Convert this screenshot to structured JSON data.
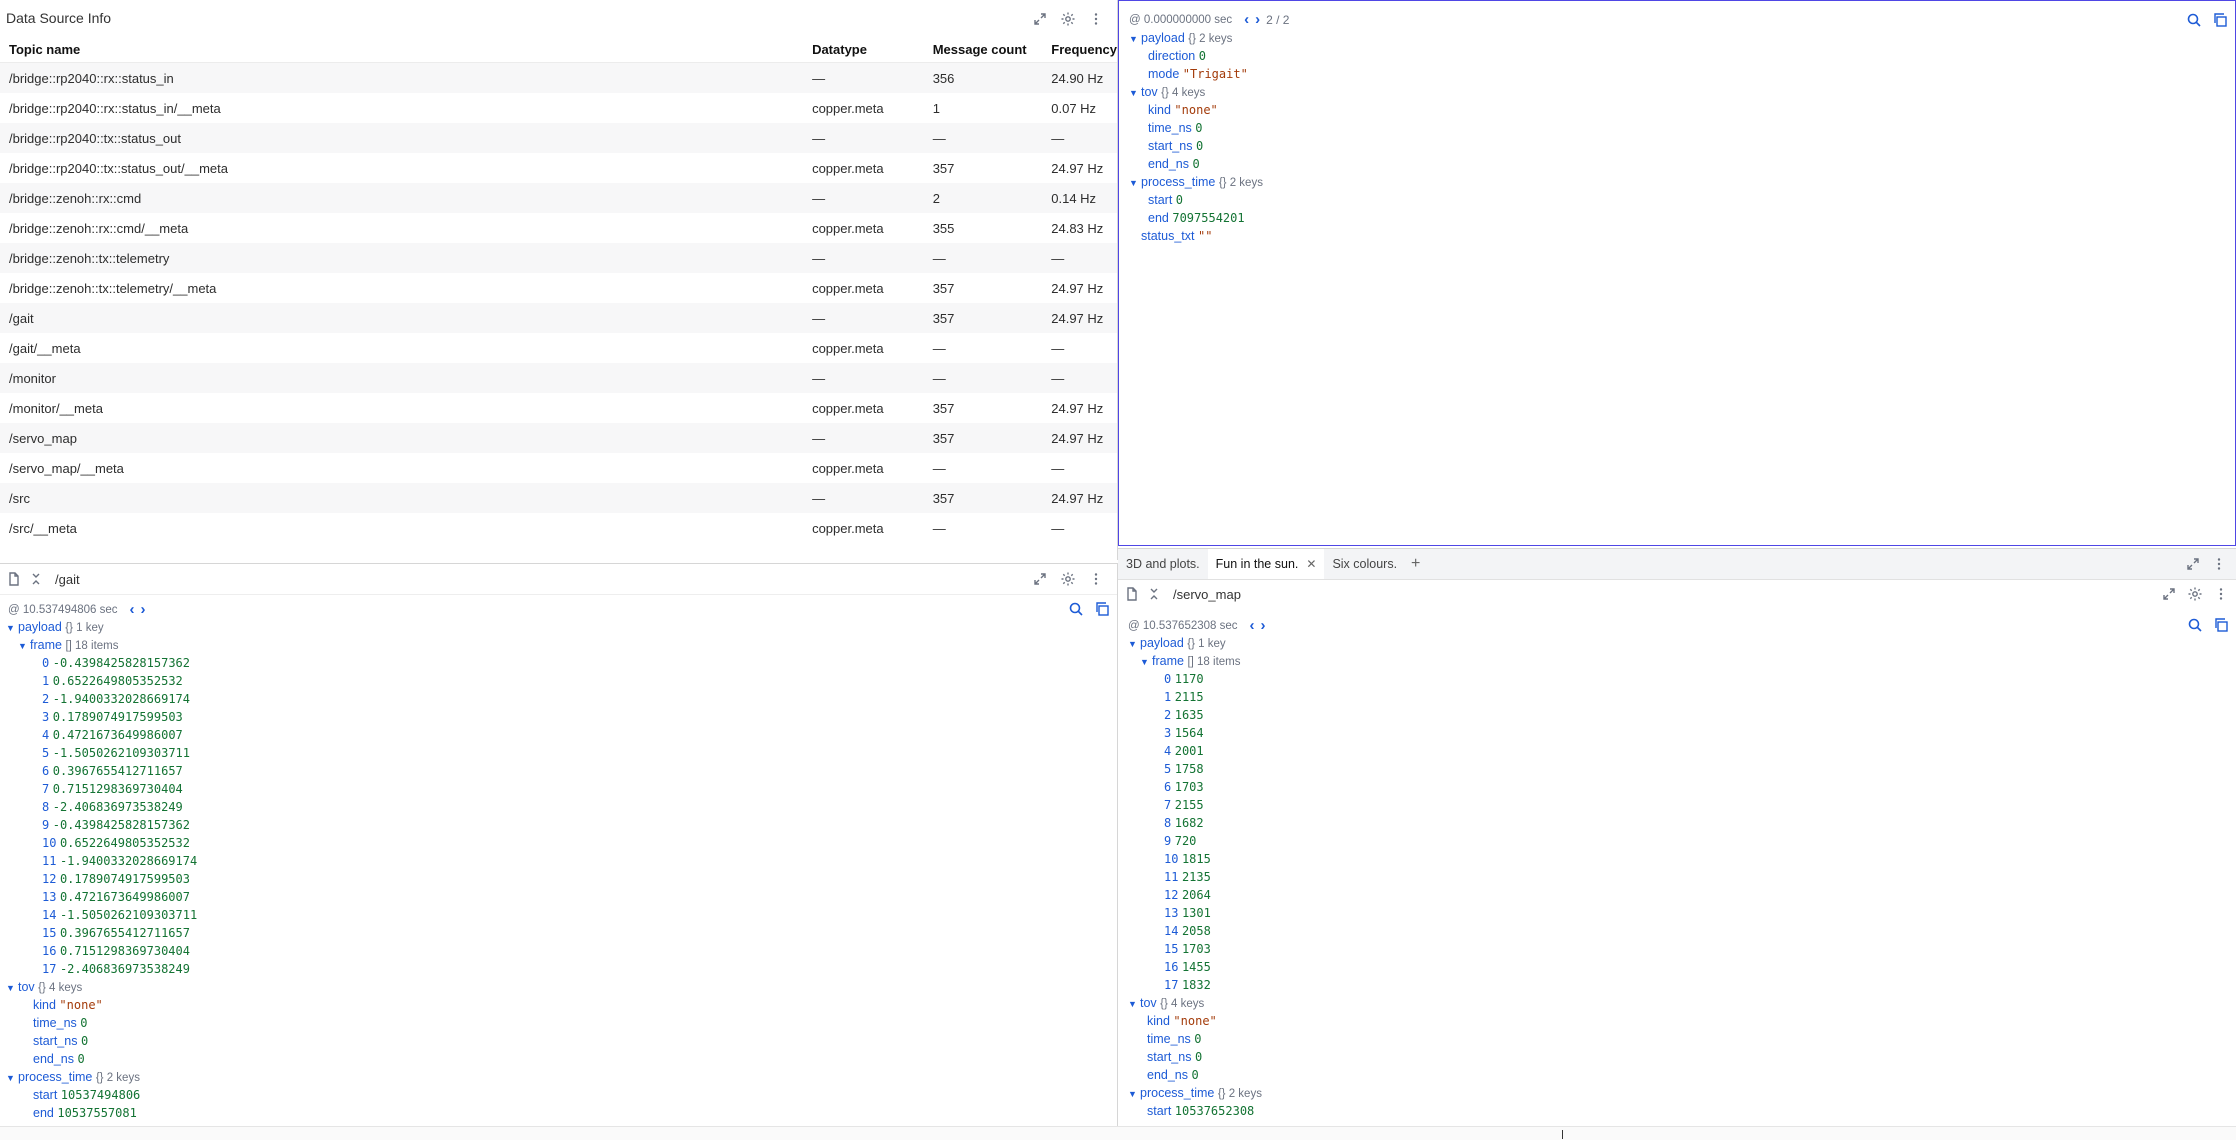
{
  "ds": {
    "title": "Data Source Info",
    "headers": [
      "Topic name",
      "Datatype",
      "Message count",
      "Frequency"
    ],
    "rows": [
      [
        "/bridge::rp2040::rx::status_in",
        "—",
        "356",
        "24.90 Hz"
      ],
      [
        "/bridge::rp2040::rx::status_in/__meta",
        "copper.meta",
        "1",
        "0.07 Hz"
      ],
      [
        "/bridge::rp2040::tx::status_out",
        "—",
        "—",
        "—"
      ],
      [
        "/bridge::rp2040::tx::status_out/__meta",
        "copper.meta",
        "357",
        "24.97 Hz"
      ],
      [
        "/bridge::zenoh::rx::cmd",
        "—",
        "2",
        "0.14 Hz"
      ],
      [
        "/bridge::zenoh::rx::cmd/__meta",
        "copper.meta",
        "355",
        "24.83 Hz"
      ],
      [
        "/bridge::zenoh::tx::telemetry",
        "—",
        "—",
        "—"
      ],
      [
        "/bridge::zenoh::tx::telemetry/__meta",
        "copper.meta",
        "357",
        "24.97 Hz"
      ],
      [
        "/gait",
        "—",
        "357",
        "24.97 Hz"
      ],
      [
        "/gait/__meta",
        "copper.meta",
        "—",
        "—"
      ],
      [
        "/monitor",
        "—",
        "—",
        "—"
      ],
      [
        "/monitor/__meta",
        "copper.meta",
        "357",
        "24.97 Hz"
      ],
      [
        "/servo_map",
        "—",
        "357",
        "24.97 Hz"
      ],
      [
        "/servo_map/__meta",
        "copper.meta",
        "—",
        "—"
      ],
      [
        "/src",
        "—",
        "357",
        "24.97 Hz"
      ],
      [
        "/src/__meta",
        "copper.meta",
        "—",
        "—"
      ]
    ]
  },
  "top_right": {
    "timestamp": "@ 0.000000000 sec",
    "page": "2 / 2",
    "payload": {
      "key": "payload",
      "meta": "{} 2 keys",
      "children": [
        [
          "direction",
          "0",
          "num"
        ],
        [
          "mode",
          "\"Trigait\"",
          "str"
        ]
      ]
    },
    "tov": {
      "key": "tov",
      "meta": "{} 4 keys",
      "children": [
        [
          "kind",
          "\"none\"",
          "str"
        ],
        [
          "time_ns",
          "0",
          "num"
        ],
        [
          "start_ns",
          "0",
          "num"
        ],
        [
          "end_ns",
          "0",
          "num"
        ]
      ]
    },
    "process_time": {
      "key": "process_time",
      "meta": "{} 2 keys",
      "children": [
        [
          "start",
          "0",
          "num"
        ],
        [
          "end",
          "7097554201",
          "num"
        ]
      ]
    },
    "status_txt": {
      "key": "status_txt",
      "value": "\"\""
    }
  },
  "bottom_left": {
    "topic": "/gait",
    "timestamp": "@ 10.537494806 sec",
    "payload": {
      "key": "payload",
      "meta": "{} 1 key"
    },
    "frame": {
      "key": "frame",
      "meta": "[] 18 items",
      "values": [
        "-0.4398425828157362",
        "0.6522649805352532",
        "-1.9400332028669174",
        "0.1789074917599503",
        "0.4721673649986007",
        "-1.5050262109303711",
        "0.3967655412711657",
        "0.7151298369730404",
        "-2.406836973538249",
        "-0.4398425828157362",
        "0.6522649805352532",
        "-1.9400332028669174",
        "0.1789074917599503",
        "0.4721673649986007",
        "-1.5050262109303711",
        "0.3967655412711657",
        "0.7151298369730404",
        "-2.406836973538249"
      ]
    },
    "tov": {
      "key": "tov",
      "meta": "{} 4 keys",
      "children": [
        [
          "kind",
          "\"none\"",
          "str"
        ],
        [
          "time_ns",
          "0",
          "num"
        ],
        [
          "start_ns",
          "0",
          "num"
        ],
        [
          "end_ns",
          "0",
          "num"
        ]
      ]
    },
    "process_time": {
      "key": "process_time",
      "meta": "{} 2 keys",
      "children": [
        [
          "start",
          "10537494806",
          "num"
        ],
        [
          "end",
          "10537557081",
          "num"
        ]
      ]
    }
  },
  "bottom_right": {
    "tabs": [
      "3D and plots.",
      "Fun in the sun.",
      "Six colours."
    ],
    "active_tab": 1,
    "topic": "/servo_map",
    "timestamp": "@ 10.537652308 sec",
    "payload": {
      "key": "payload",
      "meta": "{} 1 key"
    },
    "frame": {
      "key": "frame",
      "meta": "[] 18 items",
      "values": [
        "1170",
        "2115",
        "1635",
        "1564",
        "2001",
        "1758",
        "1703",
        "2155",
        "1682",
        "720",
        "1815",
        "2135",
        "2064",
        "1301",
        "2058",
        "1703",
        "1455",
        "1832"
      ]
    },
    "tov": {
      "key": "tov",
      "meta": "{} 4 keys",
      "children": [
        [
          "kind",
          "\"none\"",
          "str"
        ],
        [
          "time_ns",
          "0",
          "num"
        ],
        [
          "start_ns",
          "0",
          "num"
        ],
        [
          "end_ns",
          "0",
          "num"
        ]
      ]
    },
    "process_time": {
      "key": "process_time",
      "meta": "{} 2 keys",
      "children": [
        [
          "start",
          "10537652308",
          "num"
        ]
      ]
    }
  },
  "colors": {
    "accent": "#4f46e5",
    "key": "#1d5bd6",
    "number": "#137333",
    "string": "#a33b0a"
  },
  "icons": [
    "expand-icon",
    "gear-icon",
    "more-icon",
    "search-icon",
    "copy-icon",
    "file-icon",
    "collapse-icon",
    "chevron-left-icon",
    "chevron-right-icon",
    "close-icon",
    "plus-icon"
  ]
}
